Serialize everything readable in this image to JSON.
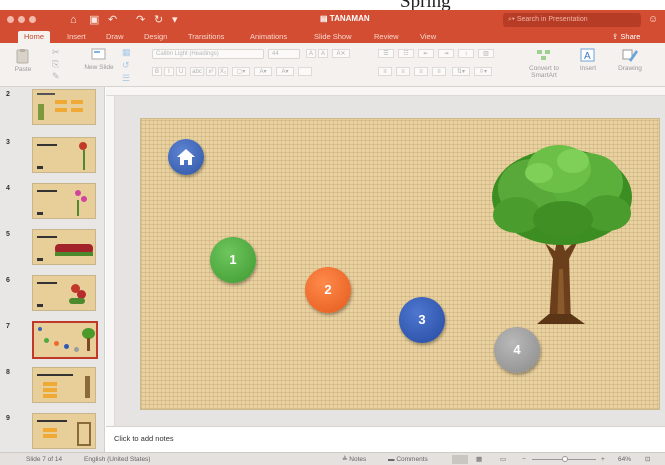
{
  "app": {
    "title": "TANAMAN",
    "search_placeholder": "Search in Presentation",
    "share_label": "Share",
    "crop_banner_text": "Spring"
  },
  "tabs": [
    {
      "label": "Home",
      "active": true
    },
    {
      "label": "Insert"
    },
    {
      "label": "Draw"
    },
    {
      "label": "Design"
    },
    {
      "label": "Transitions"
    },
    {
      "label": "Animations"
    },
    {
      "label": "Slide Show"
    },
    {
      "label": "Review"
    },
    {
      "label": "View"
    }
  ],
  "ribbon": {
    "paste_label": "Paste",
    "new_slide_label": "New Slide",
    "font_name_placeholder": "Calibri Light (Headings)",
    "font_size_placeholder": "44",
    "convert_label": "Convert to SmartArt",
    "insert_label": "Insert",
    "drawing_label": "Drawing",
    "format_buttons": [
      "B",
      "I",
      "U",
      "abc",
      "x²",
      "X₂"
    ]
  },
  "thumbnails": [
    {
      "number": "2"
    },
    {
      "number": "3"
    },
    {
      "number": "4"
    },
    {
      "number": "5"
    },
    {
      "number": "6"
    },
    {
      "number": "7",
      "selected": true
    },
    {
      "number": "8"
    },
    {
      "number": "9"
    }
  ],
  "slide": {
    "buttons": [
      {
        "label": "1",
        "color": "#4cab3f"
      },
      {
        "label": "2",
        "color": "#ee6a2b"
      },
      {
        "label": "3",
        "color": "#2f58b5"
      },
      {
        "label": "4",
        "color": "#9c9c9c"
      }
    ]
  },
  "notes": {
    "placeholder": "Click to add notes"
  },
  "status": {
    "slide_position": "Slide 7 of 14",
    "language": "English (United States)",
    "notes_label": "Notes",
    "comments_label": "Comments",
    "zoom": "64%"
  },
  "colors": {
    "accent": "#d24d32",
    "slide_background": "#e9d2a0"
  }
}
